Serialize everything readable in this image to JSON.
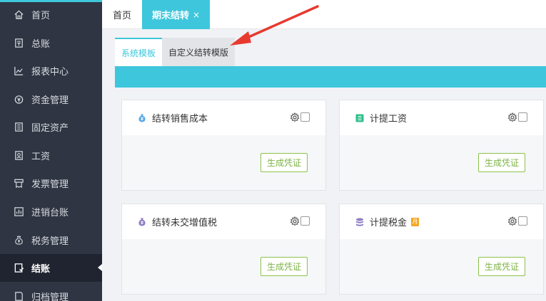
{
  "sidebar": {
    "items": [
      {
        "label": "首页",
        "icon": "home-icon"
      },
      {
        "label": "总账",
        "icon": "ledger-icon"
      },
      {
        "label": "报表中心",
        "icon": "report-chart-icon"
      },
      {
        "label": "资金管理",
        "icon": "money-icon"
      },
      {
        "label": "固定资产",
        "icon": "asset-icon"
      },
      {
        "label": "工资",
        "icon": "salary-icon"
      },
      {
        "label": "发票管理",
        "icon": "invoice-icon"
      },
      {
        "label": "进销台账",
        "icon": "inventory-icon"
      },
      {
        "label": "税务管理",
        "icon": "tax-icon"
      },
      {
        "label": "结账",
        "icon": "closing-icon"
      },
      {
        "label": "归档管理",
        "icon": "archive-icon"
      }
    ],
    "active_label": "结账"
  },
  "tabs": {
    "home_label": "首页",
    "active_label": "期末结转",
    "close_glyph": "×"
  },
  "subtabs": {
    "system_label": "系统模板",
    "custom_label": "自定义结转模版"
  },
  "cards": [
    {
      "title": "结转销售成本",
      "icon": "money-bag-icon",
      "button": "生成凭证",
      "badge": ""
    },
    {
      "title": "计提工资",
      "icon": "salary-card-icon",
      "button": "生成凭证",
      "badge": ""
    },
    {
      "title": "结转未交增值税",
      "icon": "tax-bag-icon",
      "button": "生成凭证",
      "badge": ""
    },
    {
      "title": "计提税金",
      "icon": "coins-icon",
      "button": "生成凭证",
      "badge": "月"
    }
  ],
  "colors": {
    "accent": "#3ec6dc",
    "sidebar": "#2f3542",
    "button_green": "#7cb342",
    "annotation_arrow": "#e8392f"
  }
}
